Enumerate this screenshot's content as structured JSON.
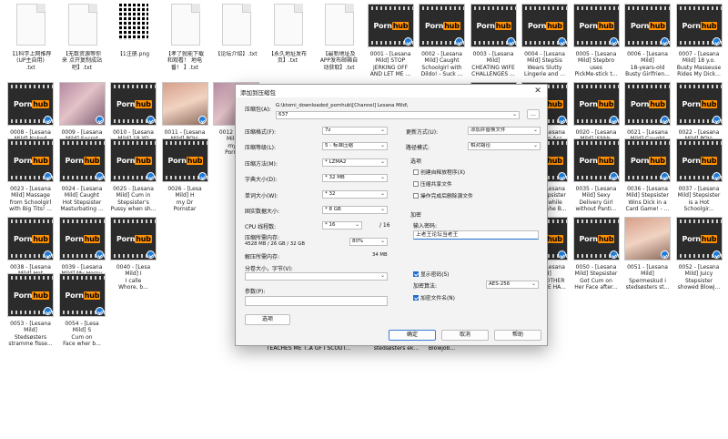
{
  "files": [
    {
      "kind": "doc",
      "label": "【1科学上网推荐\n(UP主自用)\n.txt"
    },
    {
      "kind": "doc",
      "label": "【无数资源等你\n来 点开复制成站\n吧】.txt"
    },
    {
      "kind": "qr",
      "label": "【1注册.png"
    },
    {
      "kind": "doc",
      "label": "【孝了就能下载\n和观看！ 地电\n番！ 】.txt"
    },
    {
      "kind": "doc",
      "label": "【论坛介绍】.txt"
    },
    {
      "kind": "doc",
      "label": "【永久地址发布\n页】.txt"
    },
    {
      "kind": "doc",
      "label": "【最新地址及\nAPP发布邮箱自\n动获取】.txt"
    },
    {
      "kind": "video",
      "label": "0001 - [Lesana\nMild] STOP\nJERKING OFF\nAND LET ME ..."
    },
    {
      "kind": "video",
      "label": "0002 - [Lesana\nMild] Caught\nSchoolgirl with\nDildo! - Suck ..."
    },
    {
      "kind": "video",
      "label": "0003 - [Lesana\nMild]\nCHEATING WIFE\nCHALLENGES ..."
    },
    {
      "kind": "video",
      "label": "0004 - [Lesana\nMild] StepSis\nWears Slutty\nLingerie and ..."
    },
    {
      "kind": "video",
      "label": "0005 - [Lesana\nMild] Stepbro\nuses\nPickMe-stick t..."
    },
    {
      "kind": "video",
      "label": "0006 - [Lesana\nMild]\n18-years-old\nBusty Girlfrien..."
    },
    {
      "kind": "video",
      "label": "0007 - [Lesana\nMild] 18 y.o.\nBusty Masseuse\nRides My Dick..."
    },
    {
      "kind": "video",
      "label": "0008 - [Lesana\nMild] Naked\nSurprise for the\nDelivery Man ..."
    },
    {
      "kind": "photo-a",
      "label": "0009 - [Lesana\nMild] Secret\nsex with Horny\nStepsis durin..."
    },
    {
      "kind": "video",
      "label": "0010 - [Lesana\nMild] 18 YO\nBabe in\nSwimsuit Suck..."
    },
    {
      "kind": "photo-b",
      "label": "0011 - [Lesana\nMild] POV:\nWake up next\nto your 18yo ..."
    },
    {
      "kind": "photo-a",
      "label": "0012 - [Lesa\nMild] H\nmy Dr\nPornstar"
    },
    {
      "kind": "none",
      "label": ""
    },
    {
      "kind": "none",
      "label": ""
    },
    {
      "kind": "none",
      "label": ""
    },
    {
      "kind": "none",
      "label": ""
    },
    {
      "kind": "video",
      "label": "0018 - [Lesana\nMild] POV:\nStepsis\nSeduces..."
    },
    {
      "kind": "video",
      "label": "0019 - [Lesana\nMild] Big Ass\nStepsis Never\nWears Panties..."
    },
    {
      "kind": "video",
      "label": "0020 - [Lesana\nMild] 'Shhh,\nParents are in\nthe Next Roo..."
    },
    {
      "kind": "video",
      "label": "0021 - [Lesana\nMild] Caught\nmy Naughty\nStepsister Ma..."
    },
    {
      "kind": "video",
      "label": "0022 - [Lesana\nMild] POV:\nYounger\nStepsister ask..."
    },
    {
      "kind": "video",
      "label": "0023 - [Lesana\nMild] Massage\nfrom Schoolgirl\nwith Big Tits! ..."
    },
    {
      "kind": "video",
      "label": "0024 - [Lesana\nMild] Caught\nHot Stepsister\nMasturbating ..."
    },
    {
      "kind": "video",
      "label": "0025 - [Lesana\nMild] Cum in\nStepsister's\nPussy when sh..."
    },
    {
      "kind": "video",
      "label": "0026 - [Lesa\nMild] H\nmy Dr\nPornstar"
    },
    {
      "kind": "none",
      "label": ""
    },
    {
      "kind": "none",
      "label": ""
    },
    {
      "kind": "none",
      "label": ""
    },
    {
      "kind": "none",
      "label": ""
    },
    {
      "kind": "video",
      "label": "0032 - [Lesana\nMild]\nStepsister\nFuck ..."
    },
    {
      "kind": "video",
      "label": "0033 - [Lesana\nMild] Busty\nStepsister\nCheated On h..."
    },
    {
      "kind": "video",
      "label": "0034 - [Lesana\nMild] Stepsister\nFucked while\nStuck! - She B..."
    },
    {
      "kind": "video",
      "label": "0035 - [Lesana\nMild] Sexy\nDelivery Girl\nwithout Panti..."
    },
    {
      "kind": "video",
      "label": "0036 - [Lesana\nMild] Stepsister\nWins Dick in a\nCard Game! - ..."
    },
    {
      "kind": "video",
      "label": "0037 - [Lesana\nMild] Stepsister\nis a Hot\nSchoolgir..."
    },
    {
      "kind": "video",
      "label": "0038 - [Lesana\nMild] Hot\nStepsister\nCaught with B..."
    },
    {
      "kind": "video",
      "label": "0039 - [Lesana\nMild] My Horny\nStepsister Took\nAll My Cum (6..."
    },
    {
      "kind": "video",
      "label": "0040 - [Lesa\nMild] I\nI calle\nWhore, b..."
    },
    {
      "kind": "none",
      "label": ""
    },
    {
      "kind": "none",
      "label": ""
    },
    {
      "kind": "none",
      "label": ""
    },
    {
      "kind": "none",
      "label": ""
    },
    {
      "kind": "video",
      "label": "0046 - [Lesana\nMild]\nHard\nCum ..."
    },
    {
      "kind": "video",
      "label": "0047 - [Lesana\nMild] First\nSUCK THEN\nASK! - Stepsis..."
    },
    {
      "kind": "video",
      "label": "0048 - [Lesana\nMild] Horny\nNurse With a\nPerfect Pussy ..."
    },
    {
      "kind": "video",
      "label": "0049 - [Lesana\nMild]\nSTEPBROTHER\nFUCKS ME HA..."
    },
    {
      "kind": "video",
      "label": "0050 - [Lesana\nMild] Stepsister\nGot Cum on\nHer Face after..."
    },
    {
      "kind": "photo-b",
      "label": "0051 - [Lesana\nMild]\nSpermeskud i\nstedsøsters st..."
    },
    {
      "kind": "video",
      "label": "0052 - [Lesana\nMild] Juicy\nStepsister\nshowed Blowj..."
    },
    {
      "kind": "video",
      "label": "0053 - [Lesana\nMild]\nStedsøsters\nstramme fisse..."
    },
    {
      "kind": "video",
      "label": "0054 - [Lesa\nMild] S\nCum on\nFace wher b..."
    }
  ],
  "tail_labels": [
    "TEACHES ME T...",
    "A GF I SCOUT...",
    "stedsøsters ek...",
    "Blowjob..."
  ],
  "dialog": {
    "title": "添加到压缩包",
    "close": "✕",
    "archive_label": "压缩包(A):",
    "archive_path": "G:\\ktomi_downloaded_pornhub\\[Channel] Lesana Mild\\",
    "archive_name": "637",
    "browse": "...",
    "format_label": "压缩格式(F):",
    "format_value": "7z",
    "level_label": "压缩等级(L):",
    "level_value": "5 - 标准压缩",
    "method_label": "压缩方法(M):",
    "method_value": "* LZMA2",
    "dict_label": "字典大小(D):",
    "dict_value": "* 32 MB",
    "word_label": "单词大小(W):",
    "word_value": "* 32",
    "block_label": "固实数据大小:",
    "block_value": "* 8 GB",
    "threads_label": "CPU 线程数:",
    "threads_value": "* 16",
    "threads_max": "/ 16",
    "mem_comp_label": "压缩所需内存:",
    "mem_comp_value": "4528 MB / 26 GB / 32 GB",
    "mem_percent": "80%",
    "mem_decomp_label": "解压所需内存:",
    "mem_decomp_value": "34 MB",
    "split_label": "分卷大小，字节(V):",
    "split_value": "",
    "params_label": "参数(P):",
    "params_value": "",
    "options_button": "选项",
    "update_label": "更新方式(U):",
    "update_value": "添加并替换文件",
    "pathmode_label": "路径模式:",
    "pathmode_value": "相对路径",
    "options_group": "选项",
    "opt_sfx": "创建自释放程序(X)",
    "opt_shared": "压缩共享文件",
    "opt_delete": "操作完成后删除源文件",
    "encrypt_group": "加密",
    "pw_label": "输入密码:",
    "pw_value": "上老王论坛当老王",
    "show_pw": "显示密码(S)",
    "enc_method_label": "加密算法:",
    "enc_method_value": "AES-256",
    "enc_names": "加密文件名(N)",
    "ok": "确定",
    "cancel": "取消",
    "help": "帮助"
  }
}
